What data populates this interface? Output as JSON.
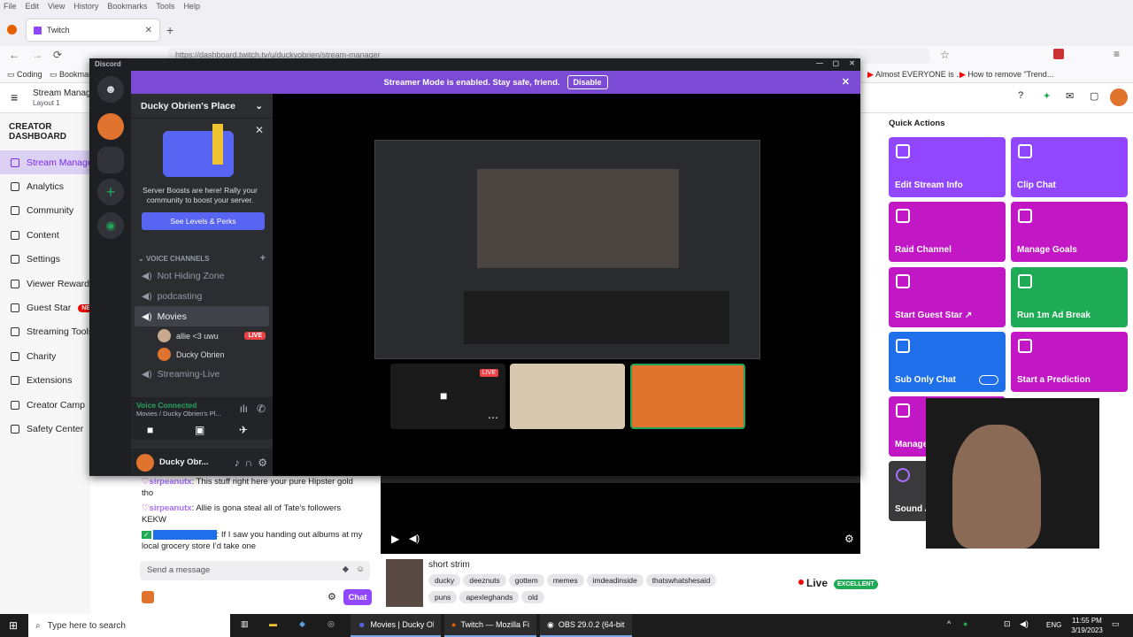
{
  "firefox": {
    "menu": [
      "File",
      "Edit",
      "View",
      "History",
      "Bookmarks",
      "Tools",
      "Help"
    ],
    "tab_title": "Twitch",
    "url": "https://dashboard.twitch.tv/u/duckyobrien/stream-manager",
    "bookmarks": [
      "Coding",
      "Bookmarks"
    ],
    "right_tabs": [
      "Almost EVERYONE is ...",
      "How to remove \"Trend..."
    ]
  },
  "twitch": {
    "page_title": "Stream Manager",
    "layout": "Layout 1",
    "sidebar_heading": "CREATOR DASHBOARD",
    "sidebar": [
      {
        "label": "Stream Manager",
        "active": true
      },
      {
        "label": "Analytics"
      },
      {
        "label": "Community"
      },
      {
        "label": "Content"
      },
      {
        "label": "Settings"
      },
      {
        "label": "Viewer Rewards"
      },
      {
        "label": "Guest Star",
        "badge": "NEW"
      },
      {
        "label": "Streaming Tools"
      },
      {
        "label": "Charity"
      },
      {
        "label": "Extensions"
      },
      {
        "label": "Creator Camp"
      },
      {
        "label": "Safety Center"
      }
    ],
    "quick_actions_title": "Quick Actions",
    "quick_actions": [
      {
        "label": "Edit Stream Info",
        "color": "#9147ff"
      },
      {
        "label": "Clip Chat",
        "color": "#9147ff"
      },
      {
        "label": "Raid Channel",
        "color": "#c217c4"
      },
      {
        "label": "Manage Goals",
        "color": "#c217c4"
      },
      {
        "label": "Start Guest Star ↗",
        "color": "#c217c4"
      },
      {
        "label": "Run 1m Ad Break",
        "color": "#1faa55"
      },
      {
        "label": "Sub Only Chat",
        "color": "#1f6feb"
      },
      {
        "label": "Start a Prediction",
        "color": "#c217c4"
      },
      {
        "label": "Manage",
        "color": "#c217c4"
      },
      {
        "label": "Sound A",
        "color": "#3a3a3d"
      }
    ],
    "chat": [
      {
        "user": "sirpeanutx",
        "msg": ": This stuff right here your pure Hipster gold tho"
      },
      {
        "user": "sirpeanutx",
        "msg": ": Allie is gona steal all of Tate's followers KEKW"
      },
      {
        "user": "",
        "msg": ": If I saw you handing out albums at my local grocery store I'd take one"
      }
    ],
    "chat_placeholder": "Send a message",
    "chat_button": "Chat",
    "stream_title": "short strim",
    "tags": [
      "ducky",
      "deeznuts",
      "gottem",
      "memes",
      "imdeadinside",
      "thatswhatshesaid",
      "puns",
      "apexleghands",
      "old"
    ],
    "live_label": "Live",
    "health": "EXCELLENT"
  },
  "discord": {
    "app": "Discord",
    "banner": "Streamer Mode is enabled. Stay safe, friend.",
    "banner_button": "Disable",
    "server_name": "Ducky Obrien's Place",
    "boost_text": "Server Boosts are here! Rally your community to boost your server.",
    "boost_button": "See Levels & Perks",
    "voice_header": "VOICE CHANNELS",
    "channels": [
      "Not Hiding Zone",
      "podcasting",
      "Movies",
      "Streaming-Live"
    ],
    "voice_users": [
      {
        "name": "allie <3 uwu",
        "live": "LIVE"
      },
      {
        "name": "Ducky Obrien"
      }
    ],
    "voice_status": "Voice Connected",
    "voice_location": "Movies / Ducky Obrien's Pl...",
    "username": "Ducky Obr...",
    "stream_live_badge": "LIVE"
  },
  "taskbar": {
    "search": "Type here to search",
    "apps": [
      "Movies | Ducky Obr...",
      "Twitch — Mozilla Fi...",
      "OBS 29.0.2 (64-bit, ..."
    ],
    "lang": "ENG",
    "time": "11:55 PM",
    "date": "3/19/2023"
  },
  "colors": {
    "twitch_purple": "#9147ff",
    "discord_bg": "#2b2d31",
    "discord_blurple": "#5865f2"
  }
}
